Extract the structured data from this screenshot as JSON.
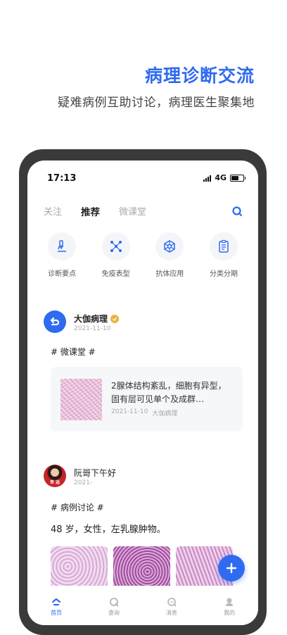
{
  "hero": {
    "title": "病理诊断交流",
    "subtitle": "疑难病例互助讨论，病理医生聚集地"
  },
  "status_bar": {
    "time": "17:13",
    "network": "4G"
  },
  "tabs": [
    {
      "label": "关注",
      "active": false
    },
    {
      "label": "推荐",
      "active": true
    },
    {
      "label": "微课堂",
      "active": false
    }
  ],
  "categories": [
    {
      "label": "诊断要点",
      "icon": "microscope-icon"
    },
    {
      "label": "免疫表型",
      "icon": "network-icon"
    },
    {
      "label": "抗体应用",
      "icon": "molecule-icon"
    },
    {
      "label": "分类分期",
      "icon": "clipboard-icon"
    }
  ],
  "posts": [
    {
      "author": "大伽病理",
      "verified": true,
      "date": "2021-11-10",
      "topic": "# 微课堂 #",
      "card": {
        "title": "2腺体结构紊乱，细胞有异型，固有层可见单个及成群…",
        "date": "2021-11-10",
        "source": "大伽病理"
      }
    },
    {
      "author": "阮哥下午好",
      "avatar_text": "幸 运",
      "date": "2021-",
      "topic": "# 病例讨论 #",
      "text": "48 岁，女性，左乳腺肿物。"
    }
  ],
  "bottom_nav": [
    {
      "label": "首页",
      "icon": "home-icon",
      "active": true
    },
    {
      "label": "查询",
      "icon": "query-icon",
      "active": false
    },
    {
      "label": "消息",
      "icon": "message-icon",
      "active": false
    },
    {
      "label": "我的",
      "icon": "profile-icon",
      "active": false
    }
  ],
  "colors": {
    "accent": "#2f6bf0",
    "verified": "#e8b43a",
    "device": "#3a3a3a"
  }
}
